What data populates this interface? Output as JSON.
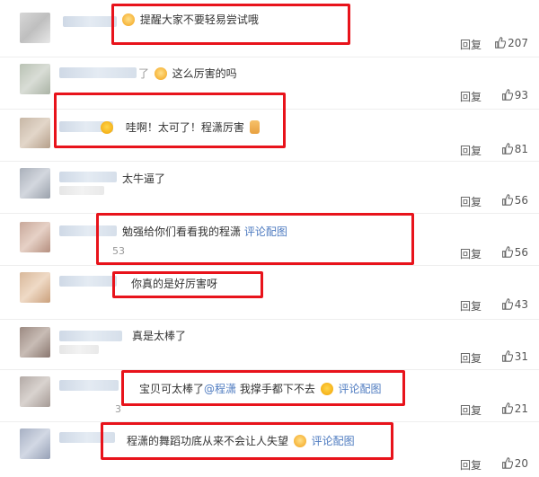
{
  "comments": [
    {
      "text_parts": [
        {
          "t": "提醒大家不要轻易尝试哦",
          "type": "plain"
        }
      ],
      "reply": "回复",
      "likes": "207"
    },
    {
      "prefix": "了",
      "text_parts": [
        {
          "t": "这么厉害的吗",
          "type": "plain"
        }
      ],
      "reply": "回复",
      "likes": "93"
    },
    {
      "text_parts": [
        {
          "t": "哇啊！太可了！程潇厉害",
          "type": "plain"
        }
      ],
      "reply": "回复",
      "likes": "81"
    },
    {
      "text_parts": [
        {
          "t": "太牛逼了",
          "type": "plain"
        }
      ],
      "reply": "回复",
      "likes": "56"
    },
    {
      "text_parts": [
        {
          "t": "勉强给你们看看我的程潇 ",
          "type": "plain"
        },
        {
          "t": "评论配图",
          "type": "link"
        }
      ],
      "stray": "53",
      "reply": "回复",
      "likes": "56"
    },
    {
      "text_parts": [
        {
          "t": "你真的是好厉害呀",
          "type": "plain"
        }
      ],
      "reply": "回复",
      "likes": "43"
    },
    {
      "text_parts": [
        {
          "t": "真是太棒了",
          "type": "plain"
        }
      ],
      "reply": "回复",
      "likes": "31"
    },
    {
      "text_parts": [
        {
          "t": "宝贝可太棒了",
          "type": "plain"
        },
        {
          "t": "@程潇",
          "type": "mention"
        },
        {
          "t": " 我撑手都下不去",
          "type": "plain"
        },
        {
          "t": "评论配图",
          "type": "link"
        }
      ],
      "stray": "3",
      "reply": "回复",
      "likes": "21"
    },
    {
      "text_parts": [
        {
          "t": "程潇的舞蹈功底从来不会让人失望",
          "type": "plain"
        },
        {
          "t": "评论配图",
          "type": "link"
        }
      ],
      "reply": "回复",
      "likes": "20"
    }
  ],
  "colors": {
    "highlight_box": "#e8131b",
    "link": "#4e7bc0",
    "text": "#333333",
    "meta": "#555555"
  },
  "icons": {
    "like": "thumbs-up-icon"
  }
}
